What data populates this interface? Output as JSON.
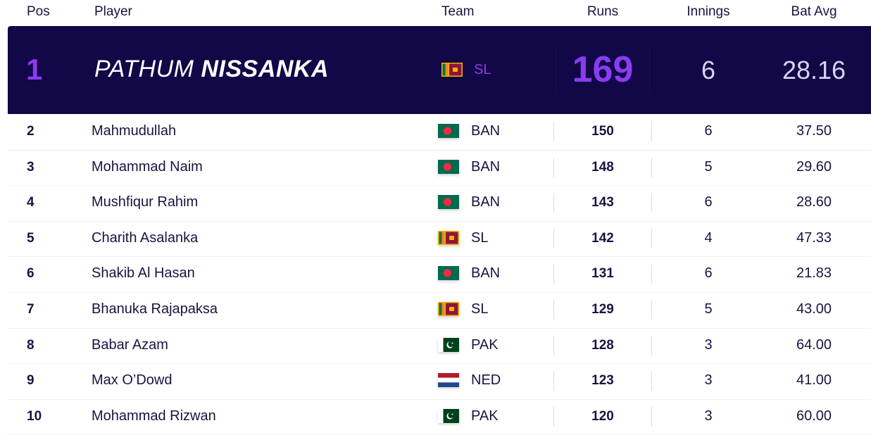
{
  "header": {
    "pos": "Pos",
    "player": "Player",
    "team": "Team",
    "runs": "Runs",
    "innings": "Innings",
    "bat_avg": "Bat Avg"
  },
  "leader": {
    "pos": "1",
    "first_name": "PATHUM",
    "last_name": "NISSANKA",
    "team": "SL",
    "flag": "sri-lanka-flag-icon",
    "runs": "169",
    "innings": "6",
    "bat_avg": "28.16"
  },
  "rows": [
    {
      "pos": "2",
      "player": "Mahmudullah",
      "team": "BAN",
      "flag": "bangladesh-flag-icon",
      "runs": "150",
      "innings": "6",
      "bat_avg": "37.50"
    },
    {
      "pos": "3",
      "player": "Mohammad Naim",
      "team": "BAN",
      "flag": "bangladesh-flag-icon",
      "runs": "148",
      "innings": "5",
      "bat_avg": "29.60"
    },
    {
      "pos": "4",
      "player": "Mushfiqur Rahim",
      "team": "BAN",
      "flag": "bangladesh-flag-icon",
      "runs": "143",
      "innings": "6",
      "bat_avg": "28.60"
    },
    {
      "pos": "5",
      "player": "Charith Asalanka",
      "team": "SL",
      "flag": "sri-lanka-flag-icon",
      "runs": "142",
      "innings": "4",
      "bat_avg": "47.33"
    },
    {
      "pos": "6",
      "player": "Shakib Al Hasan",
      "team": "BAN",
      "flag": "bangladesh-flag-icon",
      "runs": "131",
      "innings": "6",
      "bat_avg": "21.83"
    },
    {
      "pos": "7",
      "player": "Bhanuka Rajapaksa",
      "team": "SL",
      "flag": "sri-lanka-flag-icon",
      "runs": "129",
      "innings": "5",
      "bat_avg": "43.00"
    },
    {
      "pos": "8",
      "player": "Babar Azam",
      "team": "PAK",
      "flag": "pakistan-flag-icon",
      "runs": "128",
      "innings": "3",
      "bat_avg": "64.00"
    },
    {
      "pos": "9",
      "player": "Max O’Dowd",
      "team": "NED",
      "flag": "netherlands-flag-icon",
      "runs": "123",
      "innings": "3",
      "bat_avg": "41.00"
    },
    {
      "pos": "10",
      "player": "Mohammad Rizwan",
      "team": "PAK",
      "flag": "pakistan-flag-icon",
      "runs": "120",
      "innings": "3",
      "bat_avg": "60.00"
    }
  ],
  "colors": {
    "leader_bg": "#120747",
    "accent_purple": "#8a3cf2",
    "text_dark": "#1b1340"
  }
}
